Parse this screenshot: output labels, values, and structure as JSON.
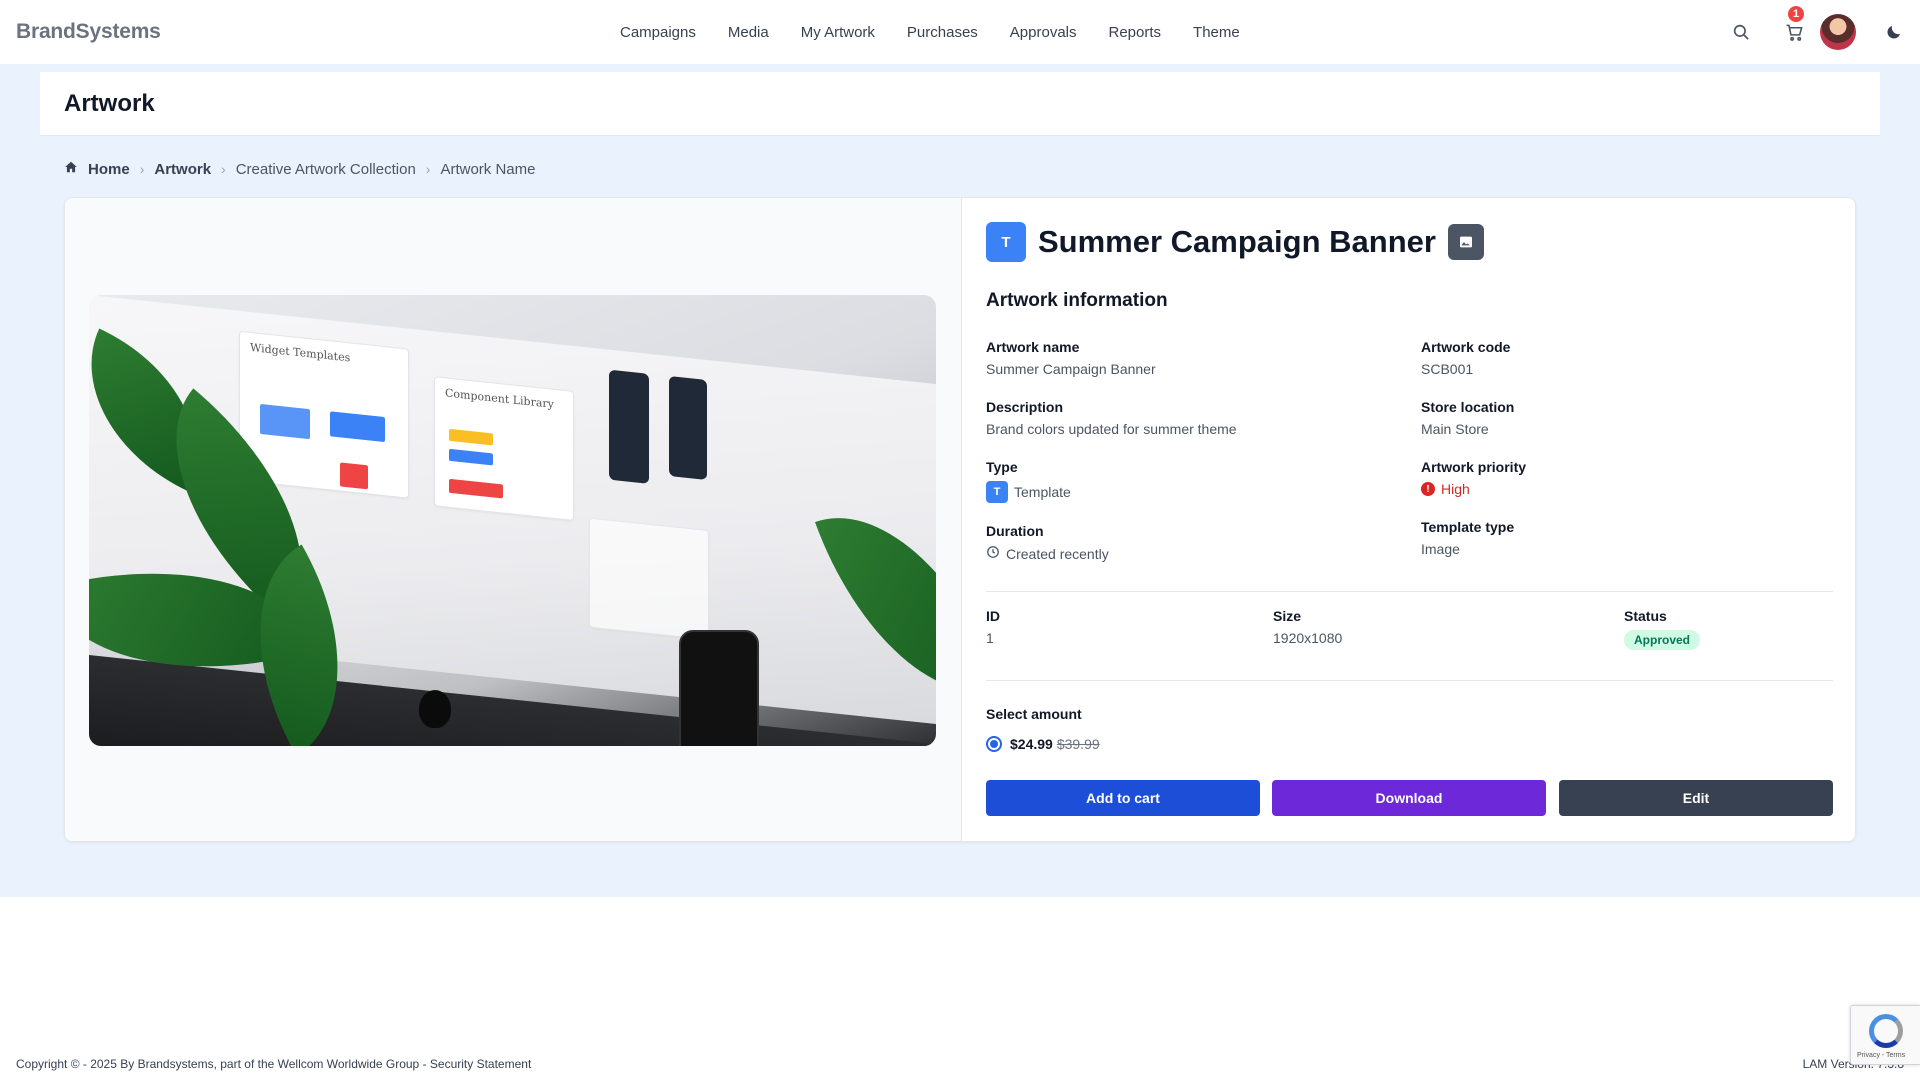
{
  "brand": "BrandSystems",
  "nav": {
    "links": [
      "Campaigns",
      "Media",
      "My Artwork",
      "Purchases",
      "Approvals",
      "Reports",
      "Theme"
    ],
    "cart_count": "1"
  },
  "page_title": "Artwork",
  "breadcrumb": [
    "Home",
    "Artwork",
    "Creative Artwork Collection",
    "Artwork Name"
  ],
  "artwork": {
    "type_badge": "T",
    "title": "Summer Campaign Banner",
    "section_title": "Artwork information",
    "fields": {
      "name_label": "Artwork name",
      "name_value": "Summer Campaign Banner",
      "code_label": "Artwork code",
      "code_value": "SCB001",
      "description_label": "Description",
      "description_value": "Brand colors updated for summer theme",
      "store_label": "Store location",
      "store_value": "Main Store",
      "type_label": "Type",
      "type_badge": "T",
      "type_value": "Template",
      "priority_label": "Artwork priority",
      "priority_value": "High",
      "duration_label": "Duration",
      "duration_value": "Created recently",
      "template_type_label": "Template type",
      "template_type_value": "Image"
    },
    "meta": {
      "id_label": "ID",
      "id_value": "1",
      "size_label": "Size",
      "size_value": "1920x1080",
      "status_label": "Status",
      "status_value": "Approved"
    },
    "pricing": {
      "label": "Select amount",
      "price": "$24.99",
      "old_price": "$39.99"
    },
    "buttons": {
      "add_to_cart": "Add to cart",
      "download": "Download",
      "edit": "Edit"
    },
    "image_mock": {
      "widget_title": "Widget Templates",
      "component_title": "Component Library"
    }
  },
  "footer": {
    "copyright": "Copyright © - 2025 By Brandsystems, part of the Wellcom Worldwide Group - Security Statement",
    "version": "LAM Version: 7.3.8",
    "recaptcha": "Privacy - Terms"
  },
  "colors": {
    "primary": "#1d4ed8",
    "download": "#6d28d9",
    "edit": "#374151",
    "priority_high": "#dc2626",
    "status_approved": "#047857",
    "background": "#eaf3fd"
  }
}
